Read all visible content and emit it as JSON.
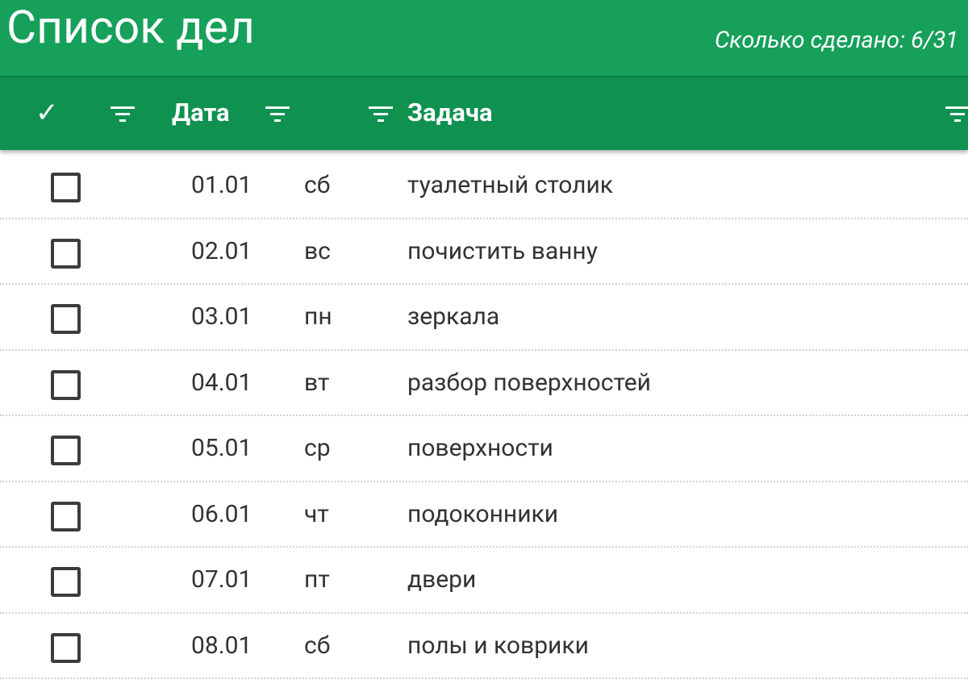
{
  "app": {
    "title": "Список дел",
    "progress": "Сколько сделано: 6/31"
  },
  "columns": {
    "check_label": "✓",
    "date_label": "Дата",
    "task_label": "Задача"
  },
  "icons": [
    "filter-icon"
  ],
  "colors": {
    "title_bar": "#16a05a",
    "header_bar": "#0f9150",
    "text": "#333333",
    "checkbox_border": "#3c3c3c"
  },
  "rows": [
    {
      "date": "01.01",
      "day": "сб",
      "task": "туалетный столик",
      "done": false
    },
    {
      "date": "02.01",
      "day": "вс",
      "task": "почистить ванну",
      "done": false
    },
    {
      "date": "03.01",
      "day": "пн",
      "task": "зеркала",
      "done": false
    },
    {
      "date": "04.01",
      "day": "вт",
      "task": "разбор поверхностей",
      "done": false
    },
    {
      "date": "05.01",
      "day": "ср",
      "task": "поверхности",
      "done": false
    },
    {
      "date": "06.01",
      "day": "чт",
      "task": "подоконники",
      "done": false
    },
    {
      "date": "07.01",
      "day": "пт",
      "task": "двери",
      "done": false
    },
    {
      "date": "08.01",
      "day": "сб",
      "task": "полы и коврики",
      "done": false
    }
  ]
}
